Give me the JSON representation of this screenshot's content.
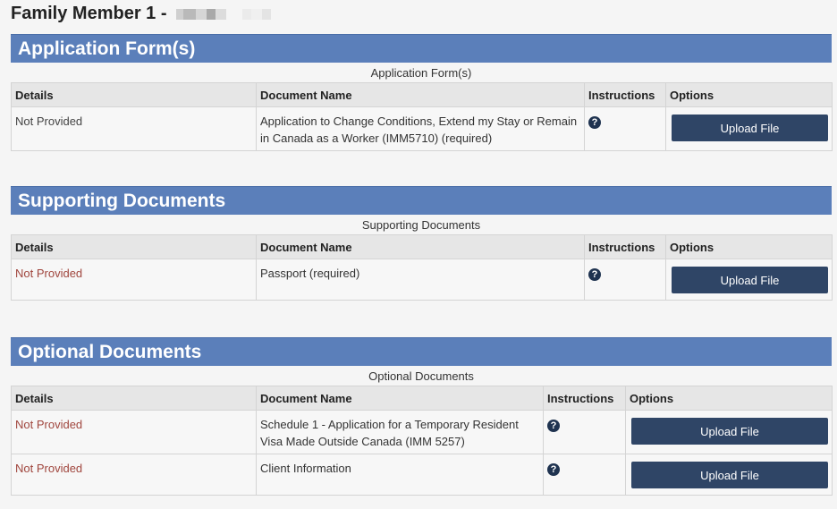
{
  "page": {
    "title": "Family Member 1 -"
  },
  "sections": [
    {
      "header": "Application Form(s)",
      "caption": "Application Form(s)",
      "columns": [
        "Details",
        "Document Name",
        "Instructions",
        "Options"
      ],
      "rows": [
        {
          "details": "Not Provided",
          "document_name": "Application to Change Conditions, Extend my Stay or Remain in Canada as a Worker (IMM5710)  (required)",
          "button": "Upload File"
        }
      ]
    },
    {
      "header": "Supporting Documents",
      "caption": "Supporting Documents",
      "columns": [
        "Details",
        "Document Name",
        "Instructions",
        "Options"
      ],
      "rows": [
        {
          "details": "Not Provided",
          "document_name": "Passport  (required)",
          "button": "Upload File"
        }
      ]
    },
    {
      "header": "Optional Documents",
      "caption": "Optional Documents",
      "columns": [
        "Details",
        "Document Name",
        "Instructions",
        "Options"
      ],
      "rows": [
        {
          "details": "Not Provided",
          "document_name": "Schedule 1 - Application for a Temporary Resident Visa Made Outside Canada (IMM 5257)",
          "button": "Upload File"
        },
        {
          "details": "Not Provided",
          "document_name": "Client Information",
          "button": "Upload File"
        }
      ]
    }
  ],
  "colors": {
    "section_header": "#5b7fba",
    "button": "#2f4566",
    "status_red": "#a0463e"
  },
  "icons": {
    "instructions": "question-circle-icon"
  }
}
